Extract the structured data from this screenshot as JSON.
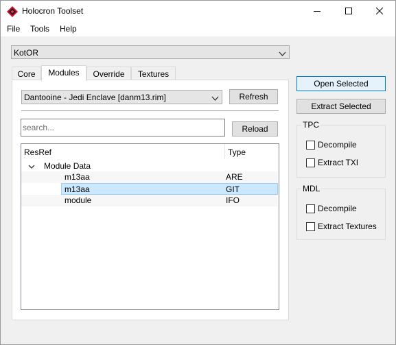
{
  "window": {
    "title": "Holocron Toolset",
    "icon": "holocron-icon",
    "controls": {
      "minimize_icon": "minimize-icon",
      "maximize_icon": "maximize-icon",
      "close_icon": "close-icon"
    }
  },
  "menubar": {
    "items": [
      "File",
      "Tools",
      "Help"
    ]
  },
  "game_select": {
    "value": "KotOR"
  },
  "tabs": [
    {
      "label": "Core",
      "active": false
    },
    {
      "label": "Modules",
      "active": true
    },
    {
      "label": "Override",
      "active": false
    },
    {
      "label": "Textures",
      "active": false
    }
  ],
  "modules_tab": {
    "module_select": {
      "value": "Dantooine - Jedi Enclave [danm13.rim]"
    },
    "refresh_label": "Refresh",
    "search": {
      "placeholder": "search...",
      "value": ""
    },
    "reload_label": "Reload",
    "tree": {
      "columns": [
        "ResRef",
        "Type"
      ],
      "group": {
        "label": "Module Data",
        "expanded": true
      },
      "rows": [
        {
          "resref": "m13aa",
          "type": "ARE",
          "selected": false
        },
        {
          "resref": "m13aa",
          "type": "GIT",
          "selected": true
        },
        {
          "resref": "module",
          "type": "IFO",
          "selected": false
        }
      ]
    }
  },
  "actions": {
    "open_selected": "Open Selected",
    "extract_selected": "Extract Selected"
  },
  "tpc_group": {
    "title": "TPC",
    "options": [
      {
        "label": "Decompile",
        "checked": false
      },
      {
        "label": "Extract TXI",
        "checked": false
      }
    ]
  },
  "mdl_group": {
    "title": "MDL",
    "options": [
      {
        "label": "Decompile",
        "checked": false
      },
      {
        "label": "Extract Textures",
        "checked": false
      }
    ]
  },
  "colors": {
    "selection_bg": "#cce8ff",
    "selection_border": "#99d1ff",
    "accent": "#0078d7",
    "app_icon_red": "#c8102e"
  }
}
